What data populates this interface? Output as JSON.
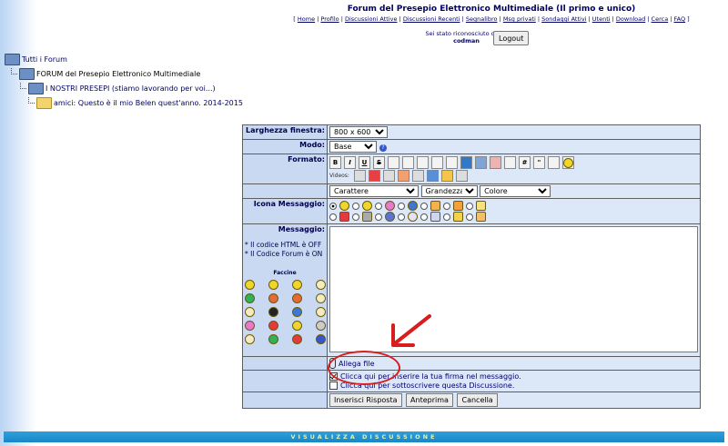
{
  "header": {
    "title": "Forum del Presepio Elettronico Multimediale (Il primo e unico)",
    "nav_open": "[ ",
    "nav_close": " ]",
    "nav_links": [
      "Home",
      "Profilo",
      "Discussioni Attive",
      "Discussioni Recenti",
      "Segnalibro",
      "Msg privati",
      "Sondaggi Attivi",
      "Utenti",
      "Download",
      "Cerca",
      "FAQ"
    ]
  },
  "login": {
    "status_text": "Sei stato riconosciuto come",
    "username": "codman",
    "logout_label": "Logout"
  },
  "breadcrumb": {
    "items": [
      "Tutti i Forum",
      "FORUM del Presepio Elettronico Multimediale",
      "I NOSTRI PRESEPI (stiamo lavorando per voi...)",
      "amici: Questo è il mio Belen quest'anno. 2014-2015"
    ]
  },
  "form": {
    "window_width_label": "Larghezza finestra:",
    "window_width_value": "800 x 600",
    "mode_label": "Modo:",
    "mode_value": "Base",
    "format_label": "Formato:",
    "format_buttons": [
      "B",
      "I",
      "U",
      "S"
    ],
    "videos_label": "Videos:",
    "font_select": "Carattere",
    "size_select": "Grandezza",
    "color_select": "Colore",
    "icon_label": "Icona Messaggio:",
    "message_label": "Messaggio:",
    "html_note": "* Il codice HTML è OFF",
    "forumcode_note": "* Il Codice Forum è ON",
    "faccine_title": "Faccine",
    "attach_label": "Allega file",
    "signature_label": "Clicca qui per inserire la tua firma nel messaggio.",
    "subscribe_label": "Clicca qui per sottoscrivere questa Discussione.",
    "submit_label": "Inserisci Risposta",
    "preview_label": "Anteprima",
    "cancel_label": "Cancella"
  },
  "footer": {
    "text": "VISUALIZZA DISCUSSIONE"
  },
  "colors": {
    "annotation": "#d71d1d",
    "label_bg": "#c9d9f1",
    "field_bg": "#dce7f7",
    "footer_bar": "#1987c6"
  }
}
